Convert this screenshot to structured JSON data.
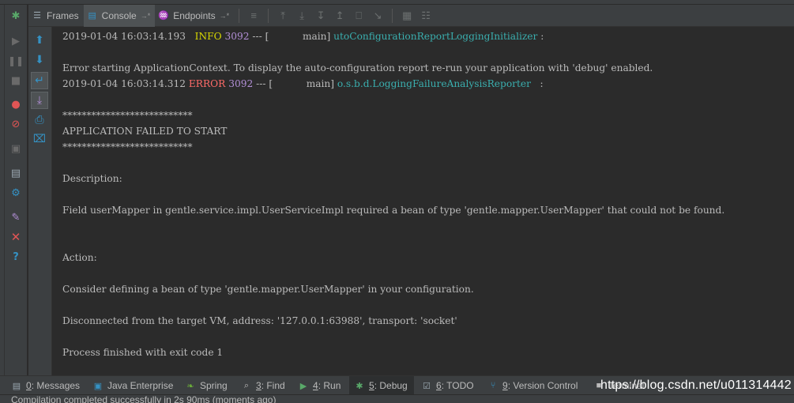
{
  "tabs": {
    "frames": "Frames",
    "console": "Console",
    "endpoints": "Endpoints",
    "pin_glyph": "→*"
  },
  "console_lines": {
    "l1": {
      "ts": "2019-01-04 16:03:14.193",
      "level": " INFO",
      "pid": "3092",
      "mid": " --- [           main] ",
      "logger": "utoConfigurationReportLoggingInitializer",
      "tail": " :"
    },
    "l2": "Error starting ApplicationContext. To display the auto-configuration report re-run your application with 'debug' enabled.",
    "l3": {
      "ts": "2019-01-04 16:03:14.312",
      "level": "ERROR",
      "pid": "3092",
      "mid": " --- [           main] ",
      "logger": "o.s.b.d.LoggingFailureAnalysisReporter",
      "tail": "   :"
    },
    "stars1": "***************************",
    "failed": "APPLICATION FAILED TO START",
    "stars2": "***************************",
    "description": "Description:",
    "field_msg": "Field userMapper in gentle.service.impl.UserServiceImpl required a bean of type 'gentle.mapper.UserMapper' that could not be found.",
    "action": "Action:",
    "consider": "Consider defining a bean of type 'gentle.mapper.UserMapper' in your configuration.",
    "disconnected": "Disconnected from the target VM, address: '127.0.0.1:63988', transport: 'socket'",
    "finished": "Process finished with exit code 1"
  },
  "bottom_tabs": {
    "messages_key": "0",
    "messages": ": Messages",
    "java_enterprise": "Java Enterprise",
    "spring": "Spring",
    "find_key": "3",
    "find": ": Find",
    "run_key": "4",
    "run": ": Run",
    "debug_key": "5",
    "debug": ": Debug",
    "todo_key": "6",
    "todo": ": TODO",
    "vcs_key": "9",
    "vcs": ": Version Control",
    "terminal": "Terminal"
  },
  "status": "Compilation completed successfully in 2s 90ms (moments ago)",
  "watermark": "https://blog.csdn.net/u011314442",
  "colors": {
    "info": "#d8d800",
    "error": "#ff6b68",
    "pid": "#b28fd6",
    "logger": "#3aafaf",
    "icon_blue": "#3592c4"
  },
  "icons": [
    "bug-icon",
    "resume-icon",
    "pause-icon",
    "stop-icon",
    "breakpoints-icon",
    "mute-breakpoints-icon",
    "camera-icon",
    "layout-icon",
    "settings-icon",
    "pin-icon",
    "close-icon",
    "help-icon",
    "up-arrow-icon",
    "down-arrow-icon",
    "soft-wrap-icon",
    "scroll-to-end-icon",
    "print-icon",
    "clear-icon"
  ]
}
